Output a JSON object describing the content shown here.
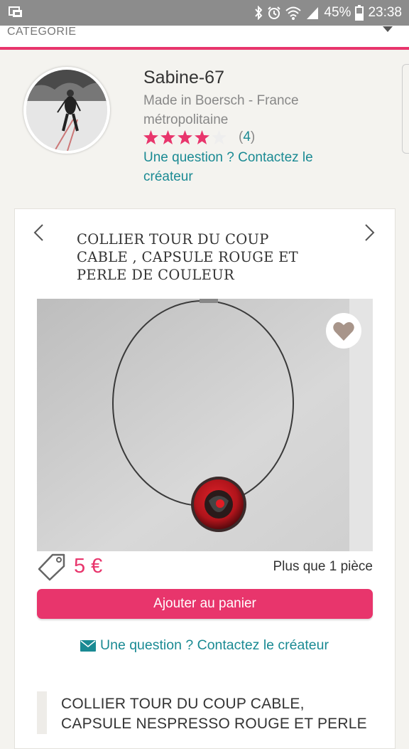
{
  "status_bar": {
    "battery": "45%",
    "time": "23:38",
    "icons": [
      "notification-icon",
      "bluetooth-icon",
      "alarm-icon",
      "wifi-icon",
      "signal-icon",
      "battery-icon"
    ]
  },
  "category": {
    "label": "CATEGORIE",
    "icon": "chevron-down-icon"
  },
  "seller": {
    "name": "Sabine-67",
    "location": "Made in Boersch - France métropolitaine",
    "rating": 4,
    "rating_max": 5,
    "review_count": "4",
    "contact_link": "Une question ? Contactez le créateur"
  },
  "product": {
    "title": "COLLIER TOUR DU COUP CABLE , CAPSULE ROUGE ET PERLE DE COULEUR",
    "price": "5 €",
    "stock": "Plus que 1 pièce",
    "add_to_cart": "Ajouter au panier",
    "contact_link": "Une question ? Contactez le créateur",
    "description_title": "COLLIER TOUR DU COUP CABLE, CAPSULE NESPRESSO ROUGE ET PERLE"
  },
  "colors": {
    "accent": "#e8356c",
    "link": "#1a8a93",
    "star": "#e8356c",
    "status_bar": "#8c8c8c"
  }
}
